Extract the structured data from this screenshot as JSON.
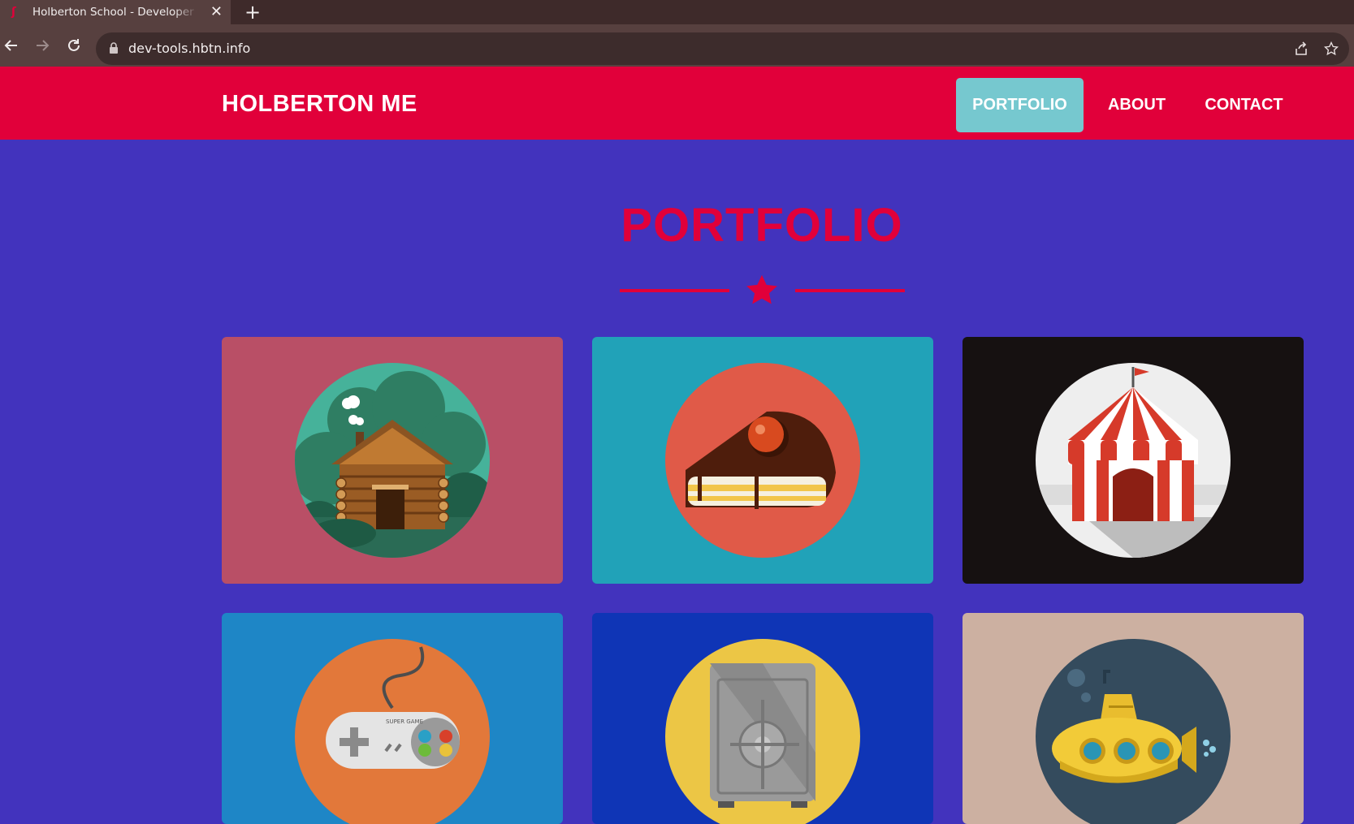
{
  "browser": {
    "tab_title": "Holberton School - Developer tools",
    "url": "dev-tools.hbtn.info"
  },
  "site": {
    "brand": "HOLBERTON ME",
    "nav": [
      {
        "label": "PORTFOLIO",
        "active": true
      },
      {
        "label": "ABOUT",
        "active": false
      },
      {
        "label": "CONTACT",
        "active": false
      }
    ],
    "accent": "#e1003a",
    "background": "#4233bd"
  },
  "portfolio": {
    "title": "PORTFOLIO",
    "items": [
      {
        "icon": "cabin-icon",
        "bg": "#b94f66"
      },
      {
        "icon": "cake-icon",
        "bg": "#21a2b8"
      },
      {
        "icon": "circus-tent-icon",
        "bg": "#161111"
      },
      {
        "icon": "game-controller-icon",
        "bg": "#1e86c6"
      },
      {
        "icon": "safe-icon",
        "bg": "#0f35b6"
      },
      {
        "icon": "submarine-icon",
        "bg": "#ccb0a1"
      }
    ],
    "controller_text": "SUPER GAME"
  }
}
